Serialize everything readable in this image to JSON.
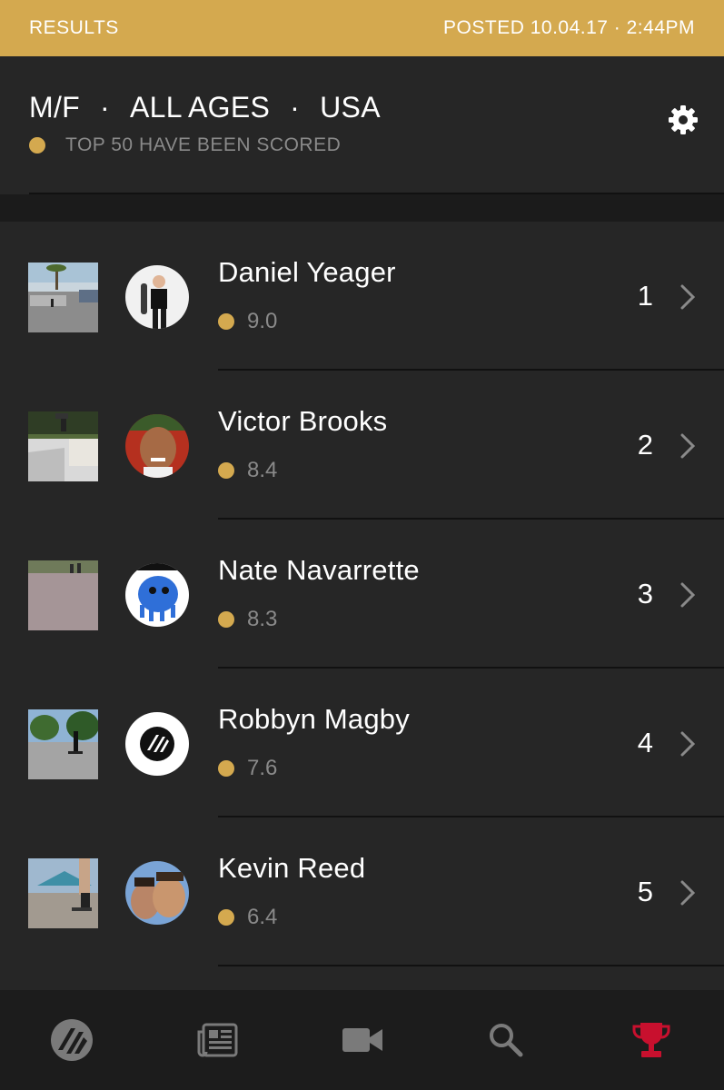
{
  "status_bar": {
    "left": "RESULTS",
    "right": "POSTED 10.04.17 · 2:44PM"
  },
  "header": {
    "filters": [
      "M/F",
      "ALL AGES",
      "USA"
    ],
    "separator": "·",
    "scored_text": "TOP 50 HAVE BEEN SCORED"
  },
  "entries": [
    {
      "name": "Daniel Yeager",
      "score": "9.0",
      "rank": "1"
    },
    {
      "name": "Victor Brooks",
      "score": "8.4",
      "rank": "2"
    },
    {
      "name": "Nate Navarrette",
      "score": "8.3",
      "rank": "3"
    },
    {
      "name": "Robbyn Magby",
      "score": "7.6",
      "rank": "4"
    },
    {
      "name": "Kevin Reed",
      "score": "6.4",
      "rank": "5"
    }
  ],
  "tabs": [
    "logo-icon",
    "news-icon",
    "video-icon",
    "search-icon",
    "trophy-icon"
  ],
  "colors": {
    "accent": "#d4a94f",
    "active_tab": "#c8102e",
    "background": "#262626",
    "tabbar": "#1c1c1c"
  }
}
